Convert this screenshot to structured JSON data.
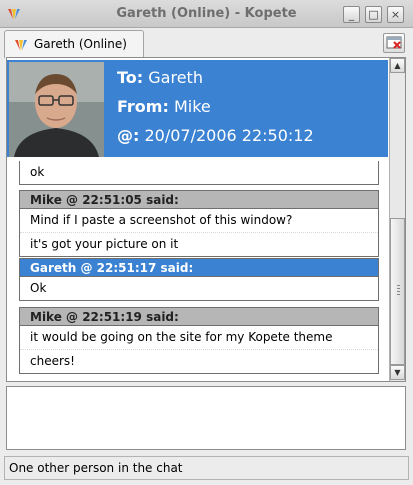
{
  "window": {
    "title": "Gareth (Online) - Kopete"
  },
  "tab": {
    "label": "Gareth (Online)"
  },
  "header": {
    "to_label": "To:",
    "to_value": "Gareth",
    "from_label": "From:",
    "from_value": "Mike",
    "at_label": "@:",
    "at_value": "20/07/2006 22:50:12"
  },
  "messages": [
    {
      "header": "",
      "lines": [
        "ok"
      ]
    },
    {
      "header": "Mike @ 22:51:05 said:",
      "lines": [
        "Mind if I paste a screenshot of this window?",
        "it's got your picture on it"
      ]
    },
    {
      "header": "Gareth @ 22:51:17 said:",
      "lines": [
        "Ok"
      ]
    },
    {
      "header": "Mike @ 22:51:19 said:",
      "lines": [
        "it would be going on the site for my Kopete theme",
        "cheers!"
      ]
    }
  ],
  "status": {
    "text": "One other person in the chat"
  },
  "colors": {
    "accent": "#3b82d2",
    "mike_header": "#b6b6b6"
  }
}
